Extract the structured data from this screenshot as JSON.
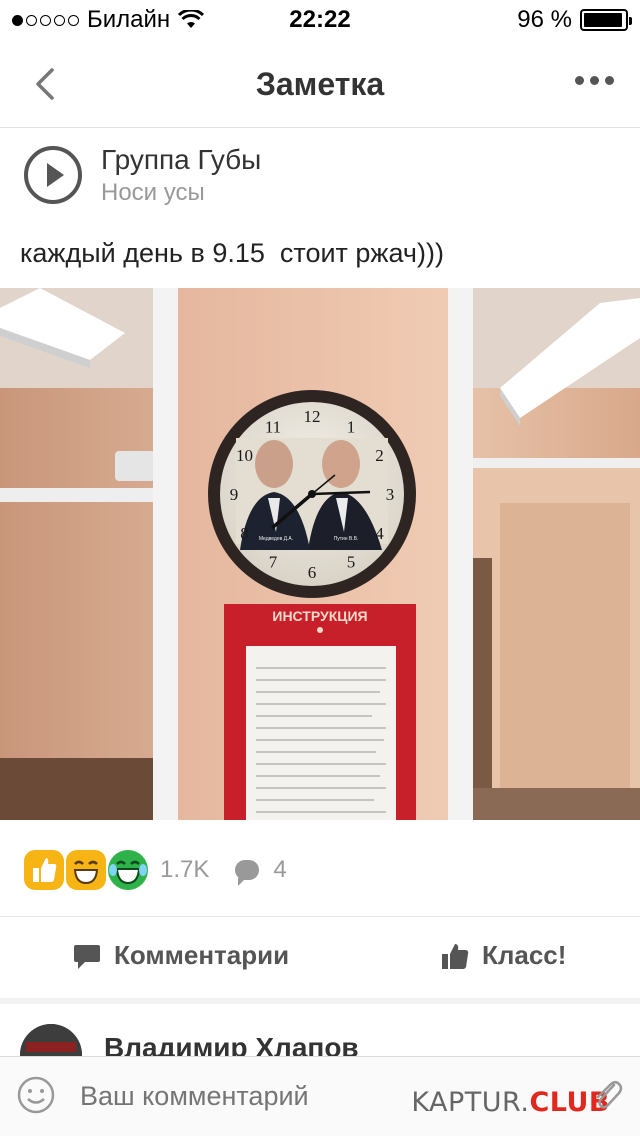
{
  "status_bar": {
    "carrier": "Билайн",
    "time": "22:22",
    "battery": "96 %",
    "battery_level": 0.96,
    "signal_bars": 1
  },
  "nav": {
    "title": "Заметка",
    "back_icon": "chevron-left-icon",
    "more_icon": "more-dots-icon"
  },
  "post": {
    "group_name": "Группа Губы",
    "group_subtitle": "Носи усы",
    "text": "каждый день в 9.15  стоит ржач)))",
    "photo": {
      "clock_numbers": [
        "12",
        "1",
        "2",
        "3",
        "4",
        "5",
        "6",
        "7",
        "8",
        "9",
        "10",
        "11"
      ],
      "portrait_caption_left": "Медведев Д.А.",
      "portrait_caption_right": "Путин В.В.",
      "board_title": "ИНСТРУКЦИЯ"
    }
  },
  "reactions": {
    "icons": [
      "thumbs-up-icon",
      "laughing-face-icon",
      "crying-laughing-face-icon"
    ],
    "likes_count": "1.7K",
    "comments_count": "4"
  },
  "actions": {
    "comment_label": "Комментарии",
    "like_label": "Класс!"
  },
  "comment_preview": {
    "author": "Владимир Хлапов"
  },
  "composer": {
    "placeholder": "Ваш комментарий",
    "watermark_main": "KAPTUR.",
    "watermark_accent": "CLUB"
  },
  "colors": {
    "accent_orange": "#f7b415",
    "accent_green": "#2fb24a",
    "board_red": "#c8202a",
    "watermark_red": "#e0281e"
  }
}
